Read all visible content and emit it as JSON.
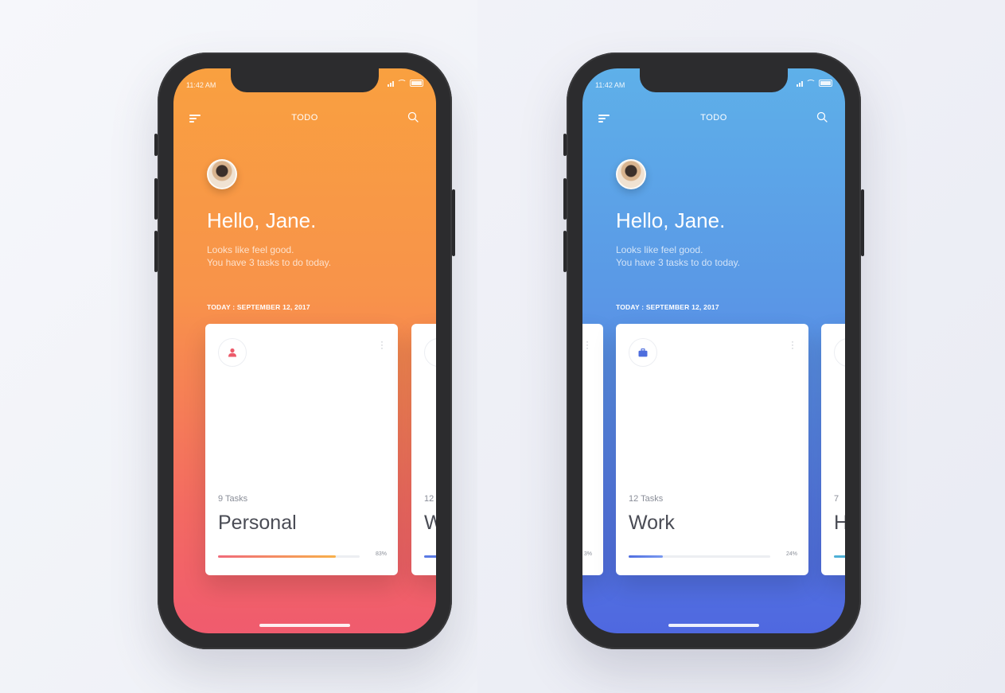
{
  "status": {
    "time": "11:42 AM"
  },
  "app": {
    "title": "TODO"
  },
  "greeting": {
    "hello": "Hello, Jane.",
    "line1": "Looks like feel good.",
    "line2": "You have 3 tasks to do today."
  },
  "date_label": "TODAY : SEPTEMBER 12, 2017",
  "themes": {
    "orange": {
      "top": "#f9a040",
      "bottom": "#f05b6e"
    },
    "blue": {
      "top": "#5eb0e9",
      "bottom": "#4f68e0"
    }
  },
  "left_screen": {
    "card": {
      "icon": "person-icon",
      "tasks": "9 Tasks",
      "name": "Personal",
      "percent": "83%",
      "progress": 0.83,
      "bar_color_start": "#f06a7a",
      "bar_color_end": "#f8b04a"
    },
    "peek_card": {
      "tasks": "12",
      "name": "W"
    }
  },
  "right_screen": {
    "card": {
      "icon": "briefcase-icon",
      "tasks": "12 Tasks",
      "name": "Work",
      "percent": "24%",
      "progress": 0.24,
      "bar_color_start": "#4f6ee0",
      "bar_color_end": "#7a9af0"
    },
    "peek_left_pct": "3%",
    "peek_right": {
      "tasks": "7",
      "name": "H"
    }
  }
}
